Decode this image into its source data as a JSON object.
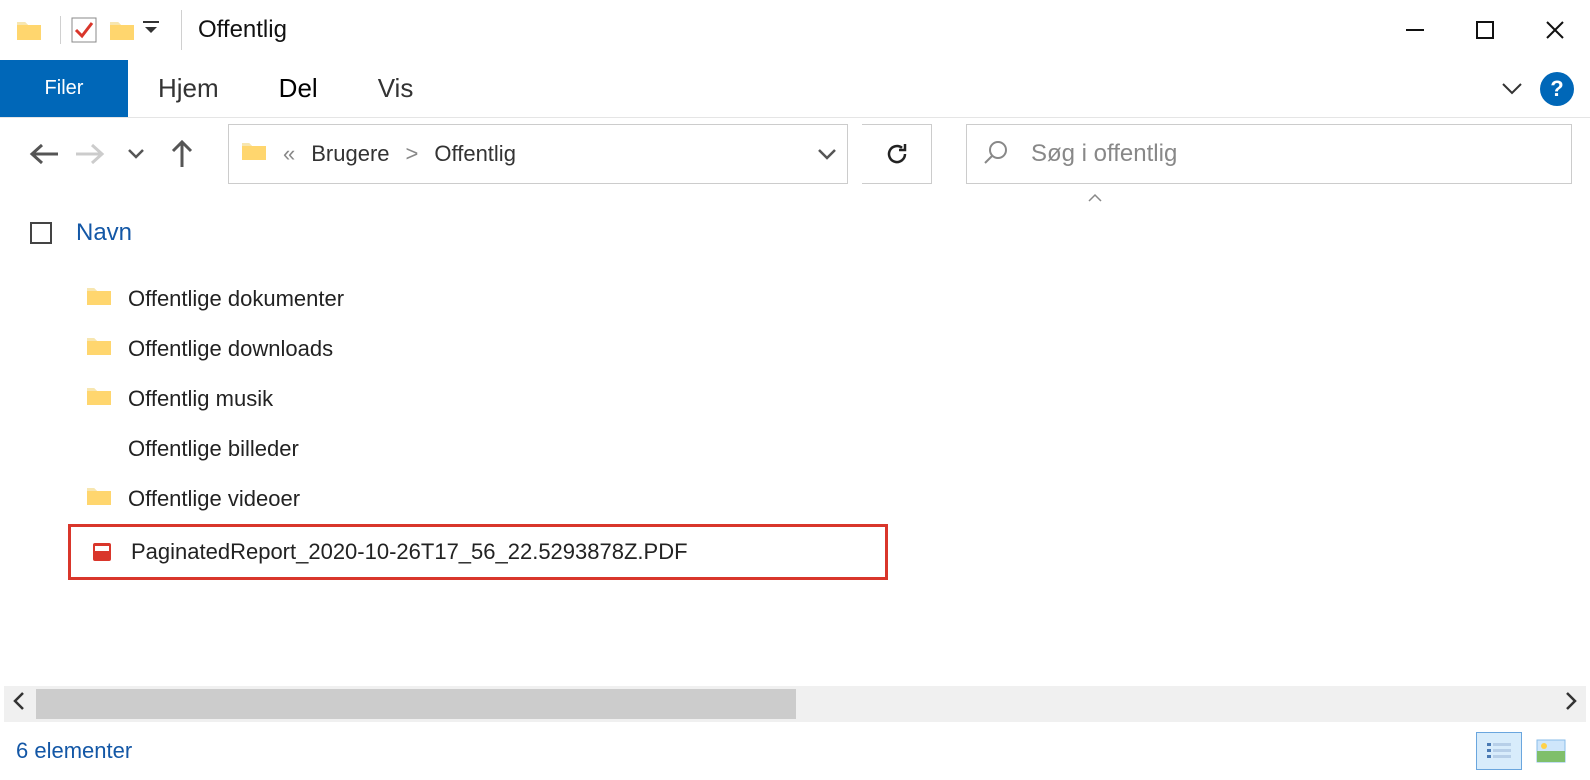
{
  "window": {
    "title": "Offentlig"
  },
  "ribbon": {
    "file": "Filer",
    "home": "Hjem",
    "share": "Del",
    "view": "Vis"
  },
  "breadcrumb": {
    "prefix": "«",
    "parent": "Brugere",
    "sep": ">",
    "current": "Offentlig"
  },
  "search": {
    "placeholder": "Søg i offentlig"
  },
  "columns": {
    "name": "Navn"
  },
  "items": [
    {
      "type": "folder",
      "label": "Offentlige dokumenter"
    },
    {
      "type": "folder",
      "label": "Offentlige downloads"
    },
    {
      "type": "folder",
      "label": "Offentlig musik"
    },
    {
      "type": "folder",
      "label": "Offentlige billeder"
    },
    {
      "type": "folder",
      "label": "Offentlige videoer"
    },
    {
      "type": "pdf",
      "label": "PaginatedReport_2020-10-26T17_56_22.5293878Z.PDF",
      "highlighted": true
    }
  ],
  "status": {
    "text": "6 elementer"
  }
}
